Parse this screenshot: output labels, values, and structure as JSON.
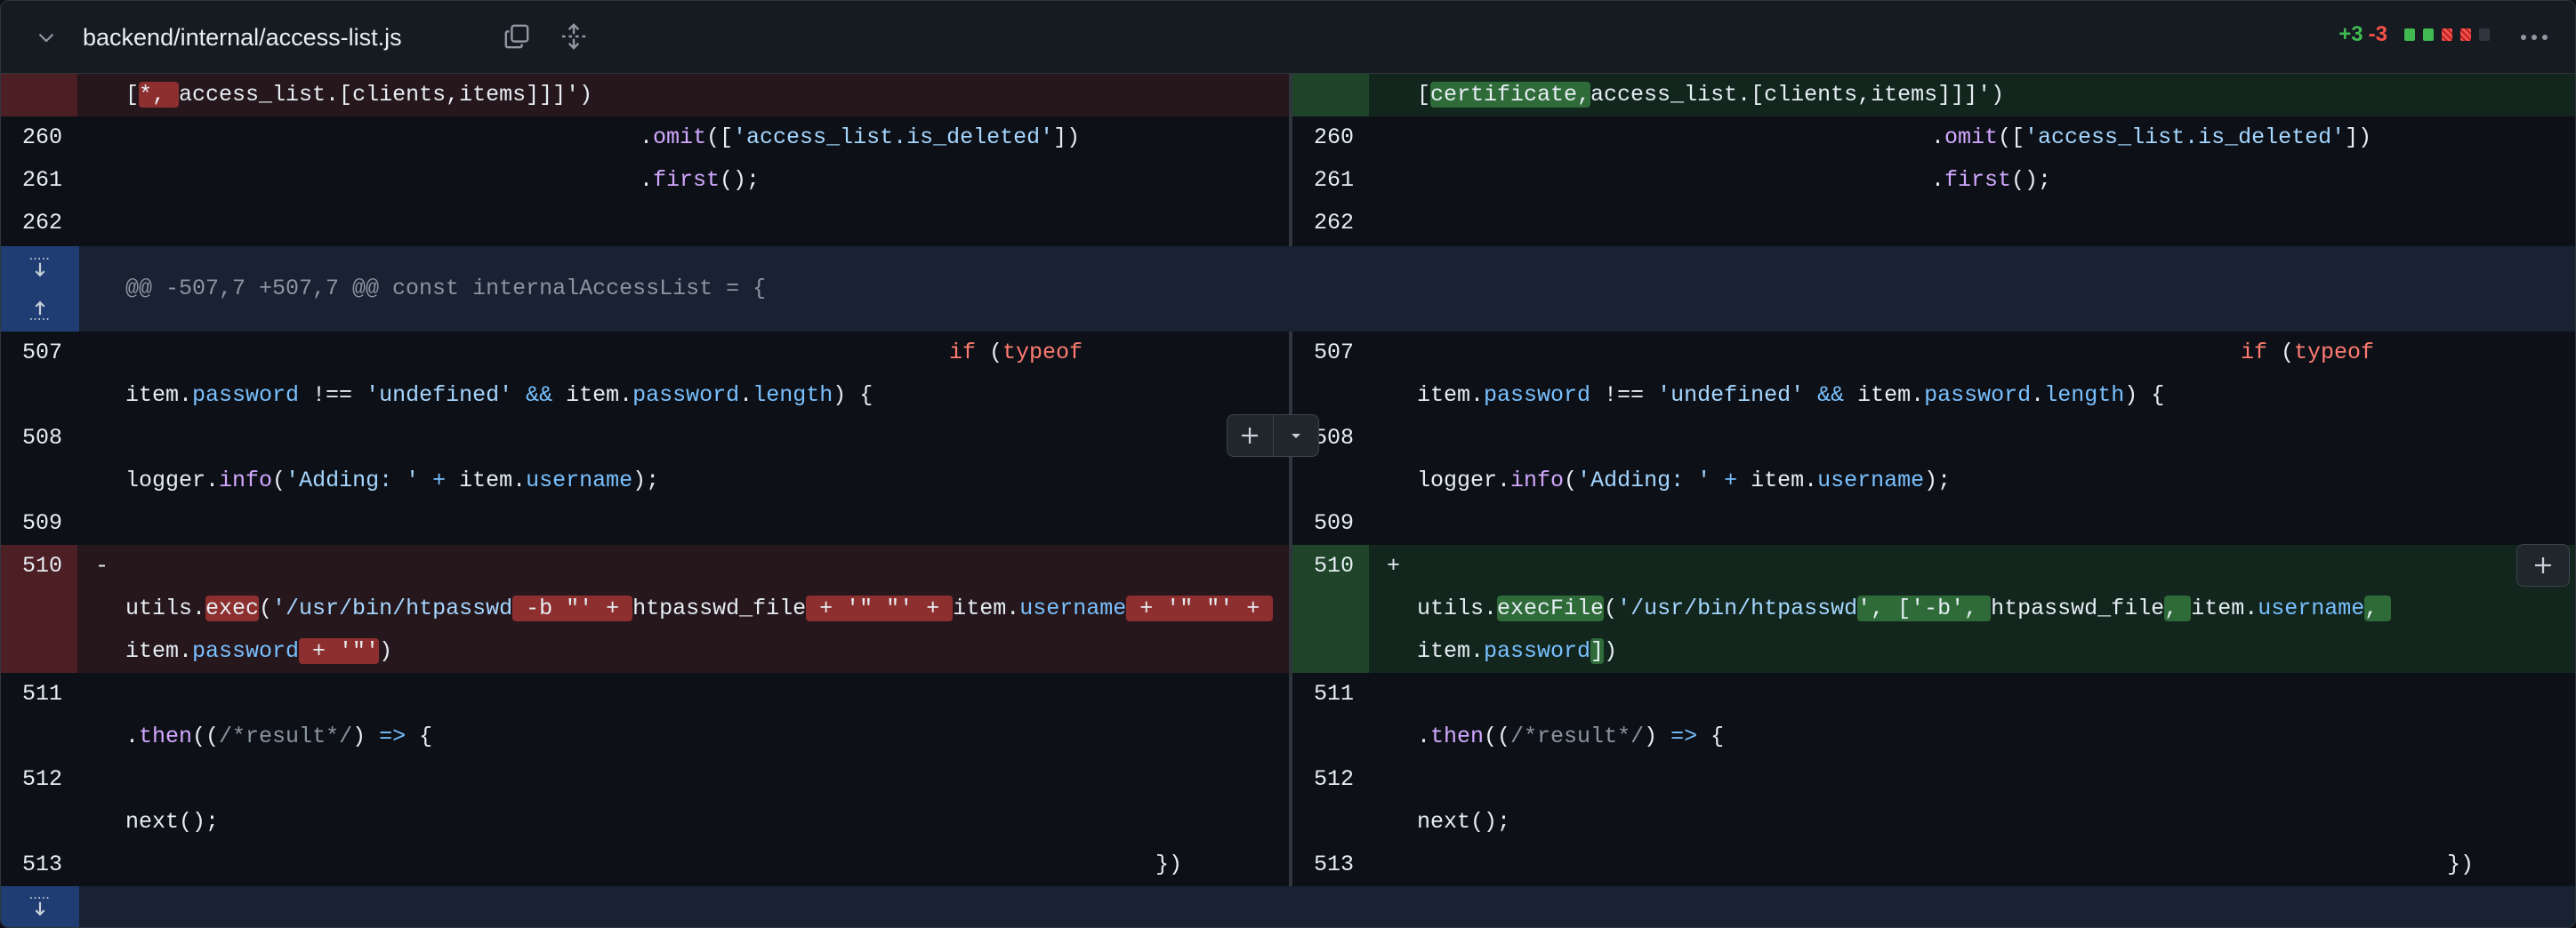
{
  "file": {
    "path": "backend/internal/access-list.js",
    "additions": "+3",
    "deletions": "-3",
    "icons": [
      "chevron-down-icon",
      "copy-icon",
      "expand-all-icon",
      "kebab-icon"
    ],
    "diffstat_colors": [
      "#3fb950",
      "#3fb950",
      "#f85149",
      "#f85149",
      "#30363d"
    ]
  },
  "hunks": {
    "second_header": "@@ -507,7 +507,7 @@ const internalAccessList = {"
  },
  "left": {
    "rows": [
      {
        "num": "",
        "type": "del",
        "code": "[*, access_list.[clients,items]]]')"
      },
      {
        "num": "260",
        "code": ".omit(['access_list.is_deleted'])"
      },
      {
        "num": "261",
        "code": ".first();"
      },
      {
        "num": "262",
        "code": ""
      },
      {
        "num": "507",
        "code": "if (typeof"
      },
      {
        "num": "",
        "code": "item.password !== 'undefined' && item.password.length) {"
      },
      {
        "num": "508",
        "code": ""
      },
      {
        "num": "",
        "code": "logger.info('Adding: ' + item.username);"
      },
      {
        "num": "509",
        "code": ""
      },
      {
        "num": "510",
        "type": "del",
        "sign": "-",
        "code": ""
      },
      {
        "num": "",
        "type": "del",
        "code": "utils.exec('/usr/bin/htpasswd -b \"' + htpasswd_file + '\" \"' + item.username + '\" \"' +"
      },
      {
        "num": "",
        "type": "del",
        "code": "item.password + '\"')"
      },
      {
        "num": "511",
        "code": ""
      },
      {
        "num": "",
        "code": ".then((/*result*/) => {"
      },
      {
        "num": "512",
        "code": ""
      },
      {
        "num": "",
        "code": "next();"
      },
      {
        "num": "513",
        "code": "})"
      }
    ]
  },
  "right": {
    "rows": [
      {
        "num": "",
        "type": "add",
        "code": "[certificate,access_list.[clients,items]]]')"
      },
      {
        "num": "260",
        "code": ".omit(['access_list.is_deleted'])"
      },
      {
        "num": "261",
        "code": ".first();"
      },
      {
        "num": "262",
        "code": ""
      },
      {
        "num": "507",
        "code": "if (typeof"
      },
      {
        "num": "",
        "code": "item.password !== 'undefined' && item.password.length) {"
      },
      {
        "num": "508",
        "code": ""
      },
      {
        "num": "",
        "code": "logger.info('Adding: ' + item.username);"
      },
      {
        "num": "509",
        "code": ""
      },
      {
        "num": "510",
        "type": "add",
        "sign": "+",
        "code": ""
      },
      {
        "num": "",
        "type": "add",
        "code": "utils.execFile('/usr/bin/htpasswd', ['-b', htpasswd_file, item.username,"
      },
      {
        "num": "",
        "type": "add",
        "code": "item.password])"
      },
      {
        "num": "511",
        "code": ""
      },
      {
        "num": "",
        "code": ".then((/*result*/) => {"
      },
      {
        "num": "512",
        "code": ""
      },
      {
        "num": "",
        "code": "next();"
      },
      {
        "num": "513",
        "code": "})"
      }
    ]
  }
}
